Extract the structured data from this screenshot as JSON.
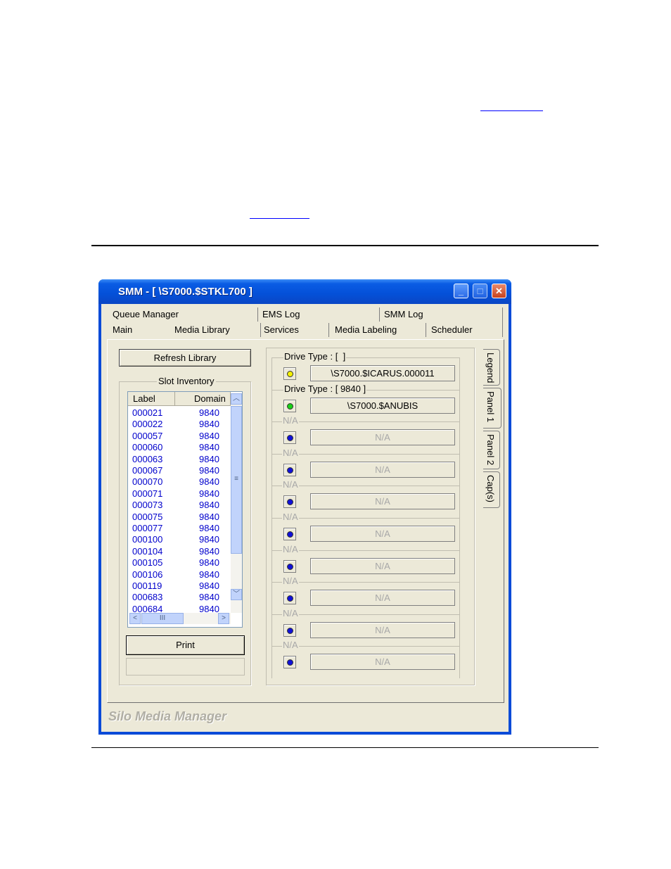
{
  "window": {
    "title": "SMM - [ \\S7000.$STKL700 ]",
    "minimize_glyph": "_",
    "maximize_glyph": "□",
    "close_glyph": "✕",
    "footer": "Silo Media Manager"
  },
  "tabs_row1": [
    "Queue Manager",
    "EMS Log",
    "SMM Log"
  ],
  "tabs_row2": [
    "Main",
    "Media Library",
    "Services",
    "Media Labeling",
    "Scheduler"
  ],
  "left": {
    "refresh_button": "Refresh Library",
    "slot_inventory_label": "Slot Inventory",
    "columns": [
      "Label",
      "Domain"
    ],
    "rows": [
      {
        "label": "000021",
        "domain": "9840"
      },
      {
        "label": "000022",
        "domain": "9840"
      },
      {
        "label": "000057",
        "domain": "9840"
      },
      {
        "label": "000060",
        "domain": "9840"
      },
      {
        "label": "000063",
        "domain": "9840"
      },
      {
        "label": "000067",
        "domain": "9840"
      },
      {
        "label": "000070",
        "domain": "9840"
      },
      {
        "label": "000071",
        "domain": "9840"
      },
      {
        "label": "000073",
        "domain": "9840"
      },
      {
        "label": "000075",
        "domain": "9840"
      },
      {
        "label": "000077",
        "domain": "9840"
      },
      {
        "label": "000100",
        "domain": "9840"
      },
      {
        "label": "000104",
        "domain": "9840"
      },
      {
        "label": "000105",
        "domain": "9840"
      },
      {
        "label": "000106",
        "domain": "9840"
      },
      {
        "label": "000119",
        "domain": "9840"
      },
      {
        "label": "000683",
        "domain": "9840"
      },
      {
        "label": "000684",
        "domain": "9840"
      }
    ],
    "print_button": "Print",
    "scroll_up": "︿",
    "scroll_down": "﹀",
    "scroll_left": "<",
    "scroll_right": ">",
    "scroll_grip_v": "≡",
    "scroll_grip_h": "III"
  },
  "drives": [
    {
      "type": "Drive Type : [  ]",
      "value": "\\S7000.$ICARUS.000011",
      "status": "yellow",
      "disabled": false
    },
    {
      "type": "Drive Type : [ 9840 ]",
      "value": "\\S7000.$ANUBIS",
      "status": "green",
      "disabled": false
    },
    {
      "type": "N/A",
      "value": "N/A",
      "status": "blue",
      "disabled": true
    },
    {
      "type": "N/A",
      "value": "N/A",
      "status": "blue",
      "disabled": true
    },
    {
      "type": "N/A",
      "value": "N/A",
      "status": "blue",
      "disabled": true
    },
    {
      "type": "N/A",
      "value": "N/A",
      "status": "blue",
      "disabled": true
    },
    {
      "type": "N/A",
      "value": "N/A",
      "status": "blue",
      "disabled": true
    },
    {
      "type": "N/A",
      "value": "N/A",
      "status": "blue",
      "disabled": true
    },
    {
      "type": "N/A",
      "value": "N/A",
      "status": "blue",
      "disabled": true
    },
    {
      "type": "N/A",
      "value": "N/A",
      "status": "blue",
      "disabled": true
    }
  ],
  "side_tabs": [
    "Legend",
    "Panel 1",
    "Panel 2",
    "Cap(s)"
  ],
  "status_colors": {
    "yellow": "#f4f000",
    "green": "#18d018",
    "blue": "#1010d8"
  }
}
